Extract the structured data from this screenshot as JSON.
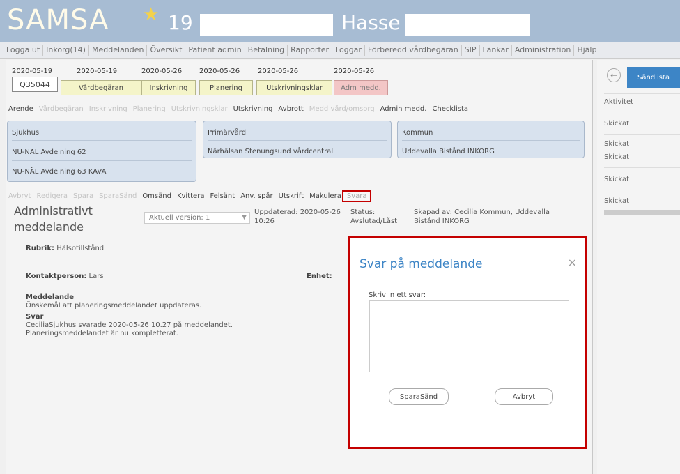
{
  "header": {
    "logo": "SAMSA",
    "count": "19",
    "user": "Hasse"
  },
  "menu": [
    "Logga ut",
    "Inkorg(14)",
    "Meddelanden",
    "Översikt",
    "Patient admin",
    "Betalning",
    "Rapporter",
    "Loggar",
    "Förberedd vårdbegäran",
    "SIP",
    "Länkar",
    "Administration",
    "Hjälp"
  ],
  "timeline": {
    "case_date": "2020-05-19",
    "case_id": "Q35044",
    "steps": [
      {
        "date": "2020-05-19",
        "label": "Vårdbegäran"
      },
      {
        "date": "2020-05-26",
        "label": "Inskrivning"
      },
      {
        "date": "2020-05-26",
        "label": "Planering"
      },
      {
        "date": "2020-05-26",
        "label": "Utskrivningsklar"
      },
      {
        "date": "2020-05-26",
        "label": "Adm medd."
      }
    ]
  },
  "tabs": [
    {
      "label": "Ärende",
      "muted": false
    },
    {
      "label": "Vårdbegäran",
      "muted": true
    },
    {
      "label": "Inskrivning",
      "muted": true
    },
    {
      "label": "Planering",
      "muted": true
    },
    {
      "label": "Utskrivningsklar",
      "muted": true
    },
    {
      "label": "Utskrivning",
      "muted": false
    },
    {
      "label": "Avbrott",
      "muted": false
    },
    {
      "label": "Medd vård/omsorg",
      "muted": true
    },
    {
      "label": "Admin medd.",
      "muted": false
    },
    {
      "label": "Checklista",
      "muted": false
    }
  ],
  "cards": [
    {
      "head": "Sjukhus",
      "lines": [
        "NU-NÄL Avdelning 62",
        "NU-NÄL Avdelning 63 KAVA"
      ]
    },
    {
      "head": "Primärvård",
      "lines": [
        "Närhälsan Stenungsund vårdcentral"
      ]
    },
    {
      "head": "Kommun",
      "lines": [
        "Uddevalla Bistånd INKORG"
      ]
    }
  ],
  "actions": [
    {
      "label": "Avbryt",
      "muted": true
    },
    {
      "label": "Redigera",
      "muted": true
    },
    {
      "label": "Spara",
      "muted": true
    },
    {
      "label": "SparaSänd",
      "muted": true
    },
    {
      "label": "Omsänd",
      "muted": false
    },
    {
      "label": "Kvittera",
      "muted": false
    },
    {
      "label": "Felsänt",
      "muted": false
    },
    {
      "label": "Anv. spår",
      "muted": false
    },
    {
      "label": "Utskrift",
      "muted": false
    },
    {
      "label": "Makulera",
      "muted": false
    },
    {
      "label": "Svara",
      "muted": false
    }
  ],
  "message": {
    "title": "Administrativt meddelande",
    "version": "Aktuell version: 1",
    "updated": "Uppdaterad: 2020-05-26 10:26",
    "status_label": "Status:",
    "status": "Avslutad/Låst",
    "created": "Skapad av: Cecilia Kommun, Uddevalla Bistånd INKORG",
    "rubrik_label": "Rubrik:",
    "rubrik": "Hälsotillstånd",
    "kontakt_label": "Kontaktperson:",
    "kontakt": "Lars",
    "enhet_label": "Enhet:",
    "medd_label": "Meddelande",
    "medd": "Önskemål att planeringsmeddelandet uppdateras.",
    "svar_label": "Svar",
    "svar_line1": "CeciliaSjukhus svarade 2020-05-26 10.27 på meddelandet.",
    "svar_line2": "Planeringsmeddelandet är nu kompletterat."
  },
  "rightpanel": {
    "tab": "Sändlista",
    "col": "Aktivitet",
    "rows": [
      "Skickat",
      "Skickat",
      "Skickat",
      "Skickat",
      "Skickat"
    ]
  },
  "dialog": {
    "title": "Svar på meddelande",
    "close": "×",
    "label": "Skriv in ett svar:",
    "save": "SparaSänd",
    "cancel": "Avbryt"
  }
}
